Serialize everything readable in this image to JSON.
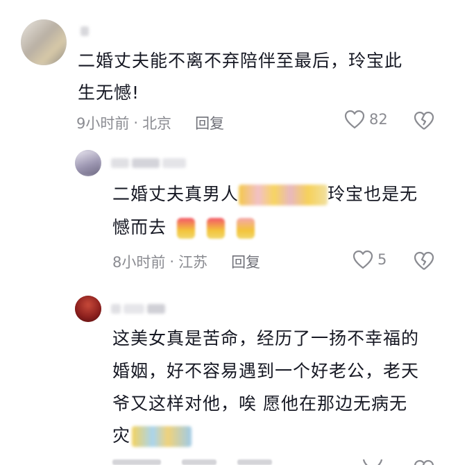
{
  "comments": [
    {
      "lines": [
        "二婚丈夫能不离不弃陪伴至最后，玲宝此",
        "生无憾!"
      ],
      "time": "9小时前",
      "dot": "·",
      "location": "北京",
      "reply_label": "回复",
      "likes": "82"
    },
    {
      "line1_start": "二婚丈夫真男人",
      "line1_end": "玲宝也是无",
      "line2": "憾而去",
      "time": "8小时前",
      "dot": "·",
      "location": "江苏",
      "reply_label": "回复",
      "likes": "5"
    },
    {
      "lines": [
        "这美女真是苦命，经历了一扬不幸福的",
        "婚姻，好不容易遇到一个好老公，老天",
        "爷又这样对他，唉   愿他在那边无病无"
      ],
      "line4": "灾",
      "time": "",
      "dot": "",
      "location": "",
      "reply_label": "",
      "likes": ""
    }
  ],
  "icons": {
    "like": "heart-outline-icon",
    "dislike": "broken-heart-icon"
  },
  "colors": {
    "text": "#161823",
    "meta": "#8a8b91",
    "icon": "#8a8b91"
  }
}
